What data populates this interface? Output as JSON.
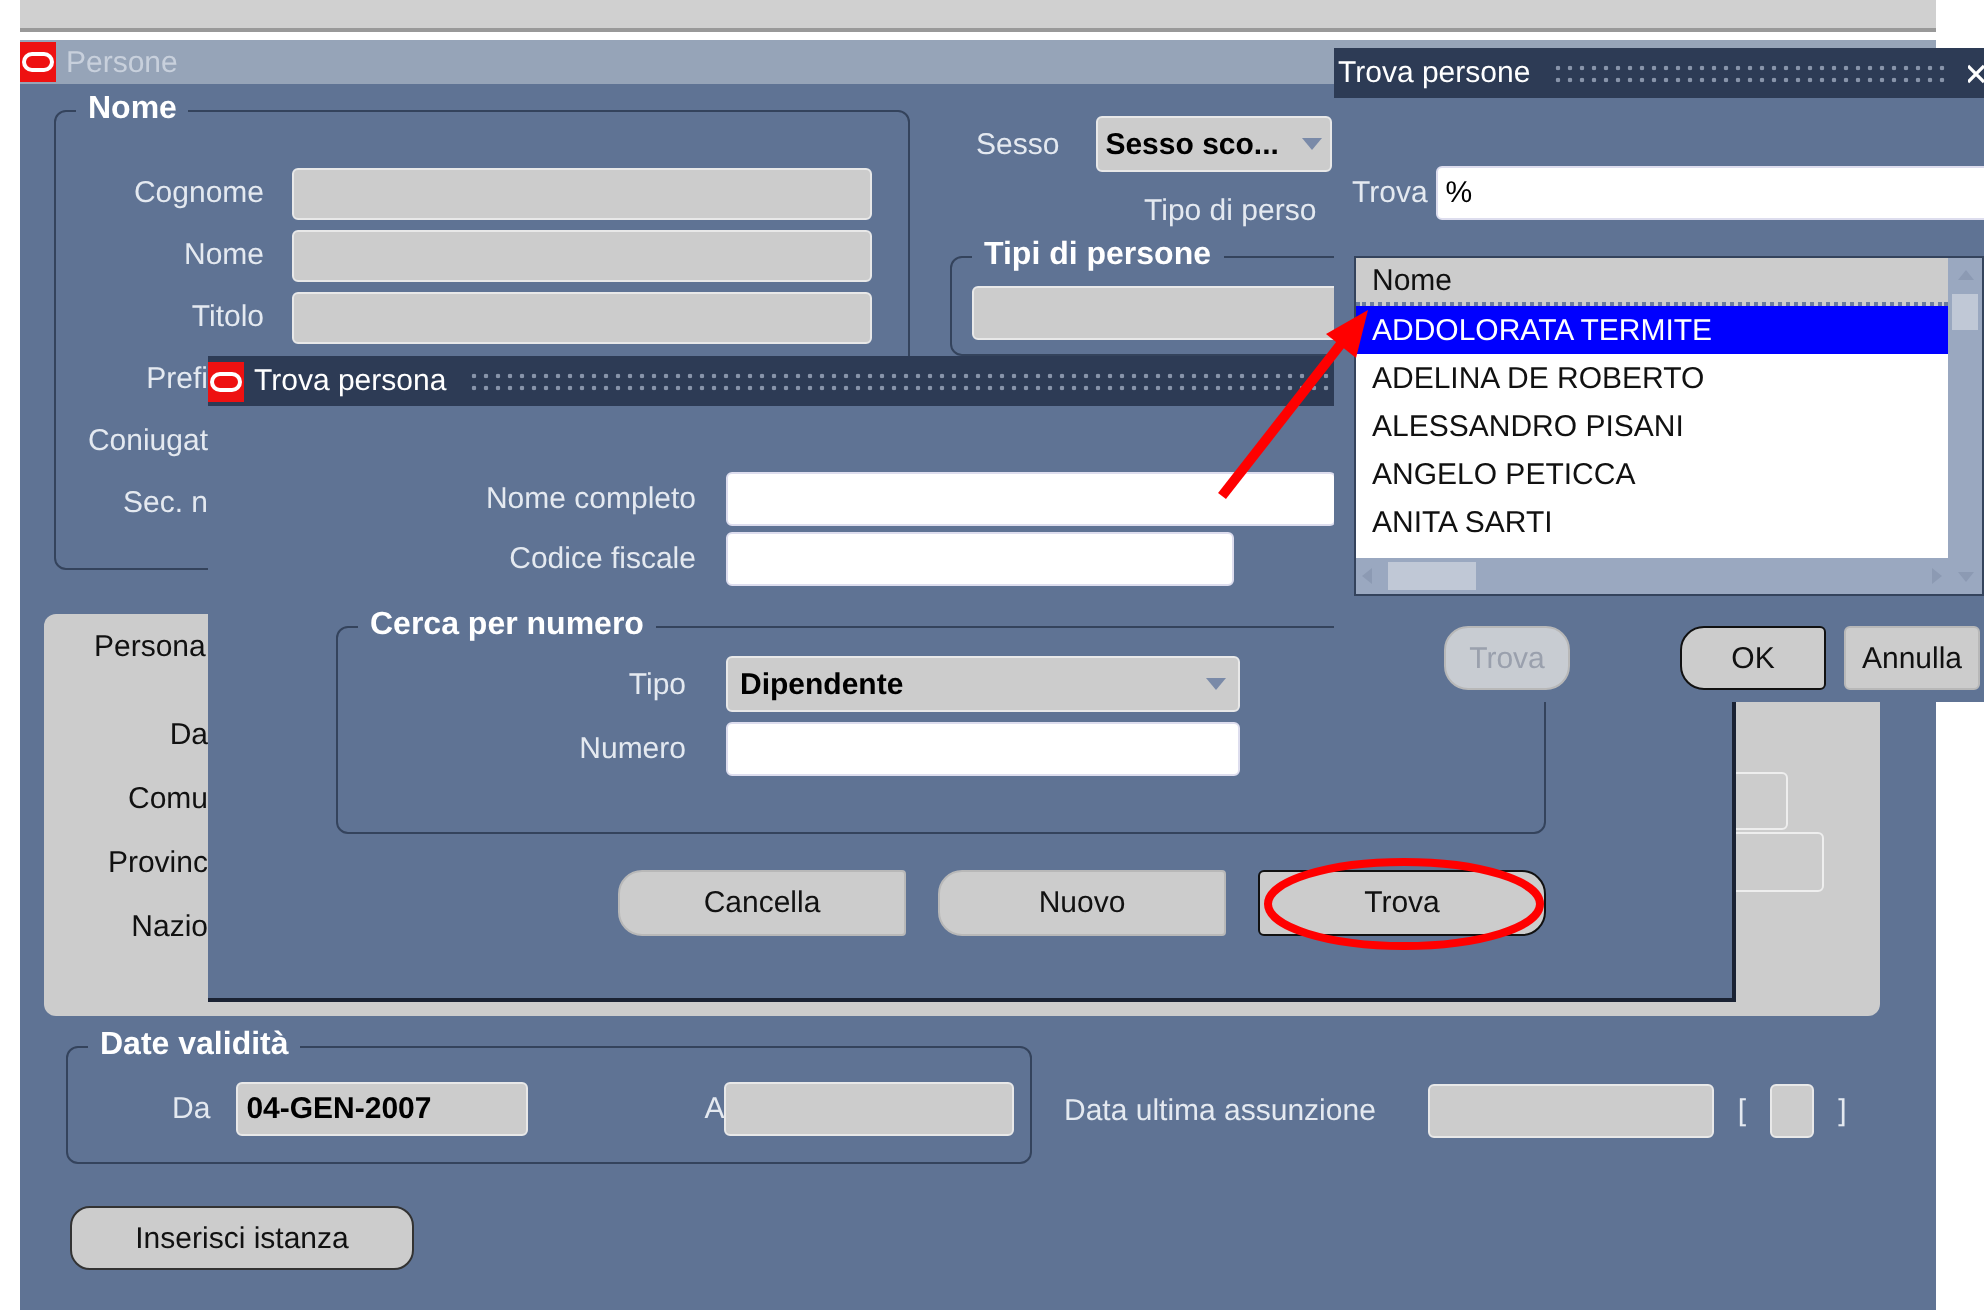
{
  "window": {
    "title": "Persone"
  },
  "nome_group": {
    "title": "Nome",
    "fields": [
      {
        "label": "Cognome",
        "kind": "input"
      },
      {
        "label": "Nome",
        "kind": "input"
      },
      {
        "label": "Titolo",
        "kind": "input"
      },
      {
        "label": "Prefi",
        "kind": "label"
      },
      {
        "label": "Coniugat",
        "kind": "label"
      },
      {
        "label": "Sec. n",
        "kind": "label"
      }
    ]
  },
  "sesso": {
    "label": "Sesso",
    "value": "Sesso sco..."
  },
  "tipo_di_persona_label": "Tipo di perso",
  "tipi_group": {
    "title": "Tipi di persone"
  },
  "address_panel": {
    "labels": [
      "Persona",
      "Da",
      "Comu",
      "Provinc",
      "Nazio"
    ]
  },
  "date_validita": {
    "title": "Date validità",
    "from_label": "Da",
    "from_value": "04-GEN-2007",
    "to_label": "A"
  },
  "data_ultima": {
    "label": "Data ultima assunzione",
    "open_bracket": "[",
    "close_bracket": "]"
  },
  "insert_button": "Inserisci istanza",
  "find_dialog": {
    "title": "Trova persona",
    "fields": [
      {
        "label": "Nome completo"
      },
      {
        "label": "Codice fiscale"
      }
    ],
    "group": {
      "title": "Cerca per numero",
      "type_label": "Tipo",
      "type_value": "Dipendente",
      "number_label": "Numero"
    },
    "buttons": [
      {
        "label": "Cancella",
        "focused": false
      },
      {
        "label": "Nuovo",
        "focused": false
      },
      {
        "label": "Trova",
        "focused": true
      }
    ]
  },
  "lov": {
    "title": "Trova persone",
    "find_label": "Trova",
    "find_value": "%",
    "column": "Nome",
    "rows": [
      {
        "name": "ADDOLORATA TERMITE",
        "selected": true
      },
      {
        "name": "ADELINA DE ROBERTO",
        "selected": false
      },
      {
        "name": "ALESSANDRO PISANI",
        "selected": false
      },
      {
        "name": "ANGELO PETICCA",
        "selected": false
      },
      {
        "name": "ANITA SARTI",
        "selected": false
      }
    ],
    "buttons": [
      {
        "label": "Trova",
        "disabled": true,
        "focused": false
      },
      {
        "label": "OK",
        "disabled": false,
        "focused": true
      },
      {
        "label": "Annulla",
        "disabled": false,
        "focused": false
      }
    ]
  }
}
